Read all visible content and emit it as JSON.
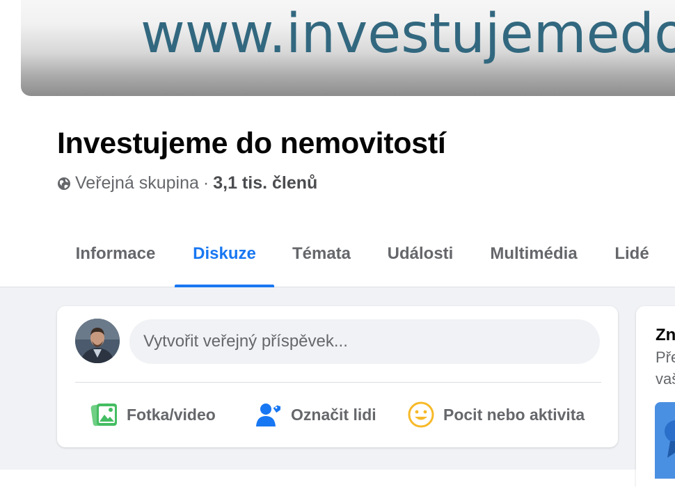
{
  "cover": {
    "text": "www.investujemedone"
  },
  "group": {
    "title": "Investujeme do nemovitostí",
    "privacy": "Veřejná skupina",
    "separator": "·",
    "members": "3,1 tis. členů"
  },
  "tabs": [
    {
      "label": "Informace"
    },
    {
      "label": "Diskuze",
      "active": true
    },
    {
      "label": "Témata"
    },
    {
      "label": "Události"
    },
    {
      "label": "Multimédia"
    },
    {
      "label": "Lidé"
    }
  ],
  "composer": {
    "placeholder": "Vytvořit veřejný příspěvek...",
    "actions": {
      "photo": "Fotka/video",
      "tag": "Označit lidi",
      "feeling": "Pocit nebo aktivita"
    }
  },
  "side_card": {
    "title": "Zn",
    "line1": "Pře",
    "line2": "vaš"
  },
  "colors": {
    "accent": "#1877f2",
    "secondary_text": "#65676b",
    "photo_icon": "#45bd62",
    "feeling_icon": "#f7b928",
    "cover_text": "#32687f"
  }
}
